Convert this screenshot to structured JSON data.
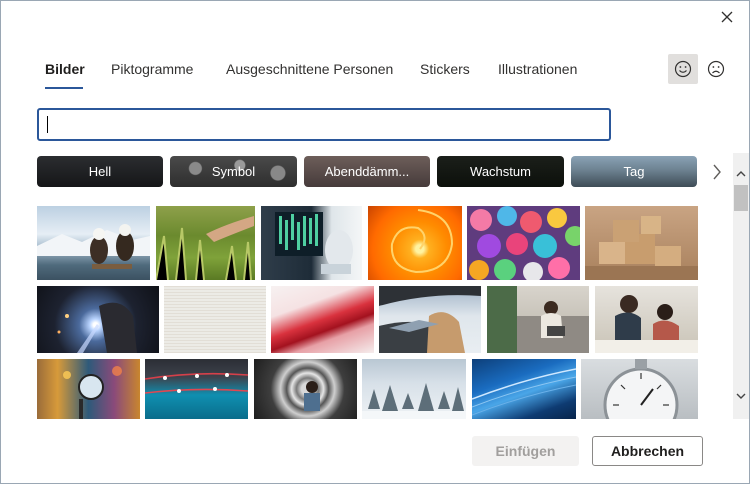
{
  "window": {
    "close_icon": "close-icon"
  },
  "tabs": [
    {
      "label": "Bilder",
      "active": true
    },
    {
      "label": "Piktogramme",
      "active": false
    },
    {
      "label": "Ausgeschnittene Personen",
      "active": false
    },
    {
      "label": "Stickers",
      "active": false
    },
    {
      "label": "Illustrationen",
      "active": false
    }
  ],
  "face_buttons": [
    {
      "name": "smile-face-icon",
      "active": true
    },
    {
      "name": "frown-face-icon",
      "active": false
    }
  ],
  "search": {
    "value": "",
    "placeholder": ""
  },
  "chips": [
    {
      "label": "Hell"
    },
    {
      "label": "Symbol"
    },
    {
      "label": "Abenddämm..."
    },
    {
      "label": "Wachstum"
    },
    {
      "label": "Tag"
    }
  ],
  "chips_next_icon": "chevron-right-icon",
  "images": [
    {
      "subject": "Adler"
    },
    {
      "subject": "Gras"
    },
    {
      "subject": "Bildschirm"
    },
    {
      "subject": "Nautilus"
    },
    {
      "subject": "Knöpfe"
    },
    {
      "subject": "Kartons"
    },
    {
      "subject": "Schweißer"
    },
    {
      "subject": "Leinen"
    },
    {
      "subject": "Rote Welle"
    },
    {
      "subject": "Autofenster"
    },
    {
      "subject": "Wohnzimmer"
    },
    {
      "subject": "Zeichnen"
    },
    {
      "subject": "Lupe"
    },
    {
      "subject": "Tropfen"
    },
    {
      "subject": "Linse"
    },
    {
      "subject": "Schneebäume"
    },
    {
      "subject": "Feder"
    },
    {
      "subject": "Stoppuhr"
    }
  ],
  "buttons": {
    "insert": "Einfügen",
    "cancel": "Abbrechen"
  }
}
